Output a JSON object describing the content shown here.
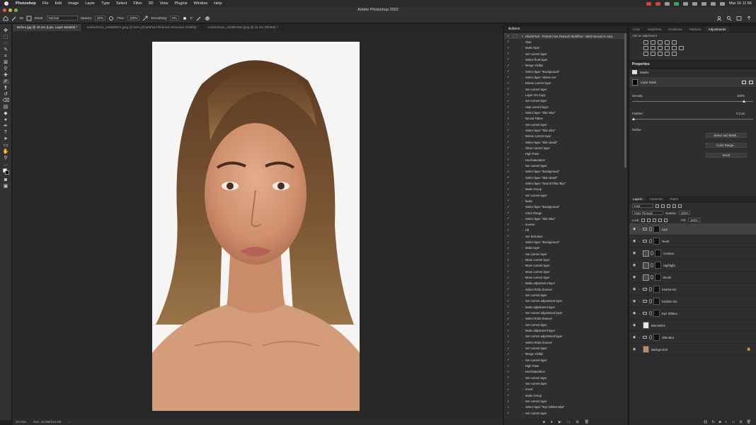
{
  "menubar": {
    "app": "Photoshop",
    "items": [
      "File",
      "Edit",
      "Image",
      "Layer",
      "Type",
      "Select",
      "Filter",
      "3D",
      "View",
      "Plugins",
      "Window",
      "Help"
    ],
    "clock": "Mar 16  11:56"
  },
  "window": {
    "title": "Adobe Photoshop 2022"
  },
  "options": {
    "mode_label": "Mode:",
    "mode_value": "Normal",
    "opacity_label": "Opacity:",
    "opacity_value": "20%",
    "flow_label": "Flow:",
    "flow_value": "100%",
    "smoothing_label": "Smoothing:",
    "smoothing_value": "0%",
    "angle_value": "0°",
    "brush_size": "80"
  },
  "tabs": [
    "Before.jpg @ 33.3% (Lips, Layer Mask/8) *",
    "AdobeStock_245985971.jpeg @ 50% (SharkPixel Redness Removal, RGB/8) *",
    "AdobeStock_165987652.jpeg @ 16.3% (RGB/8) *"
  ],
  "status": {
    "zoom": "33.33%",
    "doc": "Doc: 22.6M/164.4M"
  },
  "actions": {
    "title": "Actions",
    "set_name": "SharkPixel - Portrait Fast Retouch Workflow - NEW Neural AI copy",
    "items": [
      "Stop",
      "Make layer",
      "Set current layer",
      "Select front layer",
      "Merge Visible",
      "Select layer \"Background\"",
      "Select layer \"delete me\"",
      "Delete current layer",
      "Set current layer",
      "Layer Via Copy",
      "Set current layer",
      "Hide current layer",
      "Select layer \"Skin Blur\"",
      "Neural Filters",
      "Set current layer",
      "Select layer \"Skin Blur\"",
      "Delete current layer",
      "Select layer \"Skin detail\"",
      "Show current layer",
      "High Pass",
      "Hue/Saturation",
      "Set current layer",
      "Select layer \"Background\"",
      "Select layer \"Skin detail\"",
      "Select layer \"Neural Filter Blur\"",
      "Make Group",
      "Set current layer",
      "Make",
      "Select layer \"Background\"",
      "Color Range",
      "Select layer \"Skin Blur\"",
      "Inverse",
      "Fill",
      "Set Selection",
      "Select layer \"Background\"",
      "Make layer",
      "Set current layer",
      "Move current layer",
      "Move current layer",
      "Move current layer",
      "Move current layer",
      "Make adjustment layer",
      "Select RGB channel",
      "Set current layer",
      "Set current adjustment layer",
      "Make adjustment layer",
      "Set current adjustment layer",
      "Select RGB channel",
      "Set current layer",
      "Make adjustment layer",
      "Set current adjustment layer",
      "Select RGB channel",
      "Set current layer",
      "Merge Visible",
      "Set current layer",
      "High Pass",
      "Hue/Saturation",
      "Set current layer",
      "Set current layer",
      "Invert",
      "Make Group",
      "Set current layer",
      "Select layer \"Eye Whites Blur\"",
      "Set current layer"
    ]
  },
  "right": {
    "tabs": [
      "Color",
      "Swatches",
      "Gradients",
      "Patterns",
      "Adjustments"
    ],
    "add_adjustment": "Add an adjustment",
    "properties": {
      "title": "Properties",
      "masks": "Masks",
      "layer_mask": "Layer Mask",
      "density_label": "Density:",
      "density_value": "100%",
      "feather_label": "Feather:",
      "feather_value": "0.0 px",
      "refine_label": "Refine:",
      "select_mask": "Select and Mask...",
      "color_range": "Color Range...",
      "invert": "Invert"
    },
    "layers": {
      "tabs": [
        "Layers",
        "Channels",
        "Paths"
      ],
      "kind": "Kind",
      "blend": "Pass Through",
      "opacity_label": "Opacity:",
      "opacity_value": "100%",
      "lock_label": "Lock:",
      "fill_label": "Fill:",
      "fill_value": "100%",
      "items": [
        "Lips",
        "Teeth",
        "Contour",
        "Highlight",
        "Brush",
        "Iris/Hot Iris",
        "Iris/Dim Iris",
        "Eye Whites",
        "Blemishes",
        "Skin Blur",
        "Background"
      ]
    }
  },
  "colors": {
    "accent": "#3a78d4",
    "panel": "#2e2e2e",
    "canvas": "#282828"
  }
}
